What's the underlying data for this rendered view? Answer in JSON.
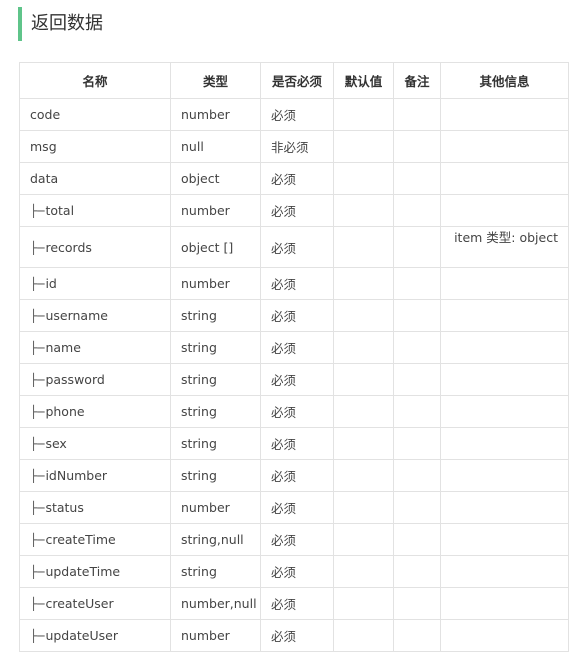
{
  "section": {
    "title": "返回数据"
  },
  "table": {
    "headers": [
      "名称",
      "类型",
      "是否必须",
      "默认值",
      "备注",
      "其他信息"
    ],
    "rows": [
      {
        "name": "code",
        "type": "number",
        "required": "必须",
        "default": "",
        "note": "",
        "other": ""
      },
      {
        "name": "msg",
        "type": "null",
        "required": "非必须",
        "default": "",
        "note": "",
        "other": ""
      },
      {
        "name": "data",
        "type": "object",
        "required": "必须",
        "default": "",
        "note": "",
        "other": ""
      },
      {
        "name": "total",
        "type": "number",
        "required": "必须",
        "default": "",
        "note": "",
        "other": ""
      },
      {
        "name": "records",
        "type": "object []",
        "required": "必须",
        "default": "",
        "note": "",
        "other": "item 类型: object"
      },
      {
        "name": "id",
        "type": "number",
        "required": "必须",
        "default": "",
        "note": "",
        "other": ""
      },
      {
        "name": "username",
        "type": "string",
        "required": "必须",
        "default": "",
        "note": "",
        "other": ""
      },
      {
        "name": "name",
        "type": "string",
        "required": "必须",
        "default": "",
        "note": "",
        "other": ""
      },
      {
        "name": "password",
        "type": "string",
        "required": "必须",
        "default": "",
        "note": "",
        "other": ""
      },
      {
        "name": "phone",
        "type": "string",
        "required": "必须",
        "default": "",
        "note": "",
        "other": ""
      },
      {
        "name": "sex",
        "type": "string",
        "required": "必须",
        "default": "",
        "note": "",
        "other": ""
      },
      {
        "name": "idNumber",
        "type": "string",
        "required": "必须",
        "default": "",
        "note": "",
        "other": ""
      },
      {
        "name": "status",
        "type": "number",
        "required": "必须",
        "default": "",
        "note": "",
        "other": ""
      },
      {
        "name": "createTime",
        "type": "string,null",
        "required": "必须",
        "default": "",
        "note": "",
        "other": ""
      },
      {
        "name": "updateTime",
        "type": "string",
        "required": "必须",
        "default": "",
        "note": "",
        "other": ""
      },
      {
        "name": "createUser",
        "type": "number,null",
        "required": "必须",
        "default": "",
        "note": "",
        "other": ""
      },
      {
        "name": "updateUser",
        "type": "number",
        "required": "必须",
        "default": "",
        "note": "",
        "other": ""
      }
    ],
    "tree_prefix": "├─"
  }
}
